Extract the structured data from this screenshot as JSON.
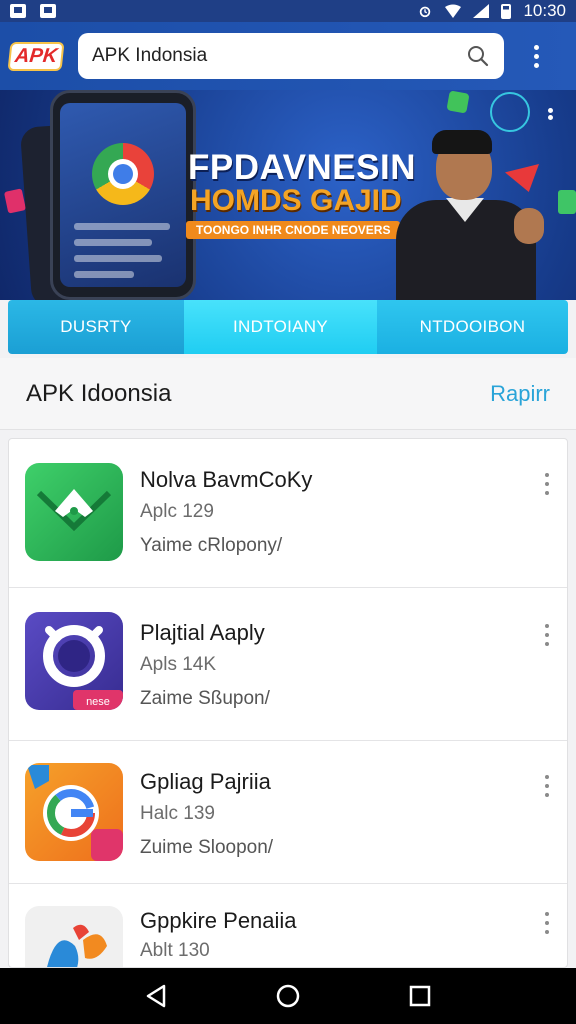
{
  "status_bar": {
    "time": "10:30"
  },
  "app_bar": {
    "logo_text": "APK",
    "search_value": "APK Indonsia"
  },
  "banner": {
    "title": "FPDAVNESIN",
    "subtitle": "HOMDS GAJID",
    "tagline": "TOONGO INHR CNODE NEOVERS"
  },
  "tabs": [
    {
      "label": "DUSRTY"
    },
    {
      "label": "INDTOIANY"
    },
    {
      "label": "NTDOOIBON"
    }
  ],
  "section": {
    "title": "APK Idoonsia",
    "link": "Rapirr"
  },
  "apps": [
    {
      "title": "Nolva BavmCoKy",
      "sub": "Aplc 129",
      "meta": "Yaime cRlopony/",
      "icon": "green-envelope-icon",
      "accent": "#27b35a"
    },
    {
      "title": "Plajtial Aaply",
      "sub": "Apls 14K",
      "meta": "Zaime Sßupon/",
      "icon": "purple-ring-icon",
      "accent": "#4c3fa8",
      "badge": "nese"
    },
    {
      "title": "Gpliag Pajriia",
      "sub": "Halc 139",
      "meta": "Zuime Sloopon/",
      "icon": "orange-g-icon",
      "accent": "#f28a20"
    },
    {
      "title": "Gppkire Penaiia",
      "sub": "Ablt 130",
      "meta": "",
      "icon": "colorful-shapes-icon",
      "accent": "#2a8ad8"
    }
  ]
}
